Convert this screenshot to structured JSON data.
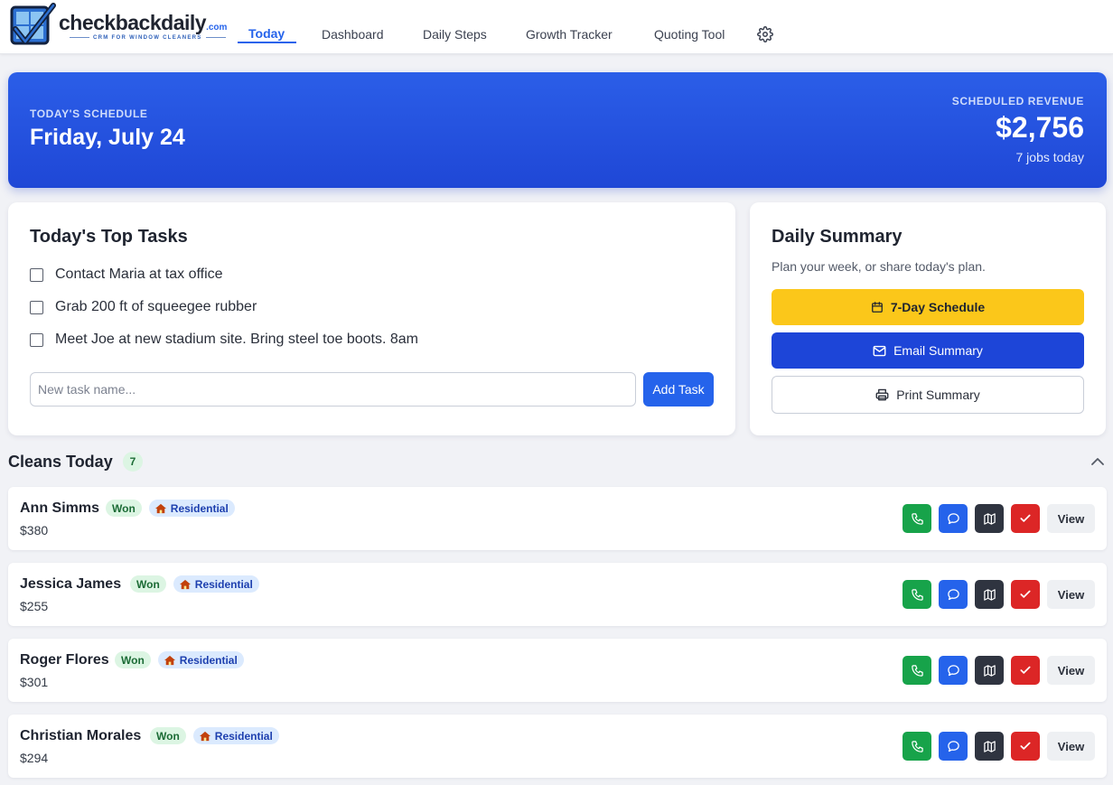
{
  "brand": {
    "name": "checkbackdaily",
    "tld": ".com",
    "tagline": "CRM FOR WINDOW CLEANERS"
  },
  "nav": {
    "items": [
      {
        "label": "Today",
        "active": true
      },
      {
        "label": "Dashboard"
      },
      {
        "label": "Daily Steps"
      },
      {
        "label": "Growth Tracker"
      },
      {
        "label": "Quoting Tool"
      }
    ],
    "settings_icon": "gear-icon"
  },
  "hero": {
    "label": "TODAY'S SCHEDULE",
    "date": "Friday, July 24",
    "revenue_label": "SCHEDULED REVENUE",
    "revenue": "$2,756",
    "jobs": "7 jobs today"
  },
  "tasks": {
    "title": "Today's Top Tasks",
    "items": [
      {
        "text": "Contact Maria at tax office",
        "done": false
      },
      {
        "text": "Grab 200 ft of squeegee rubber",
        "done": false
      },
      {
        "text": "Meet Joe at new stadium site. Bring steel toe boots. 8am",
        "done": false
      }
    ],
    "input_placeholder": "New task name...",
    "add_label": "Add Task"
  },
  "summary": {
    "title": "Daily Summary",
    "subtitle": "Plan your week, or share today's plan.",
    "schedule_label": "7-Day Schedule",
    "email_label": "Email Summary",
    "print_label": "Print Summary"
  },
  "cleans": {
    "title": "Cleans Today",
    "count": "7",
    "jobs": [
      {
        "name": "Ann Simms",
        "status": "Won",
        "type": "Residential",
        "price": "$380"
      },
      {
        "name": "Jessica James",
        "status": "Won",
        "type": "Residential",
        "price": "$255"
      },
      {
        "name": "Roger Flores",
        "status": "Won",
        "type": "Residential",
        "price": "$301"
      },
      {
        "name": "Christian Morales",
        "status": "Won",
        "type": "Residential",
        "price": "$294"
      }
    ],
    "view_label": "View"
  },
  "colors": {
    "primary": "#2563eb",
    "hero": "#1f47d6",
    "yellow": "#fbc71a",
    "green": "#17a34a",
    "red": "#dc2626",
    "dark": "#2f3440"
  }
}
